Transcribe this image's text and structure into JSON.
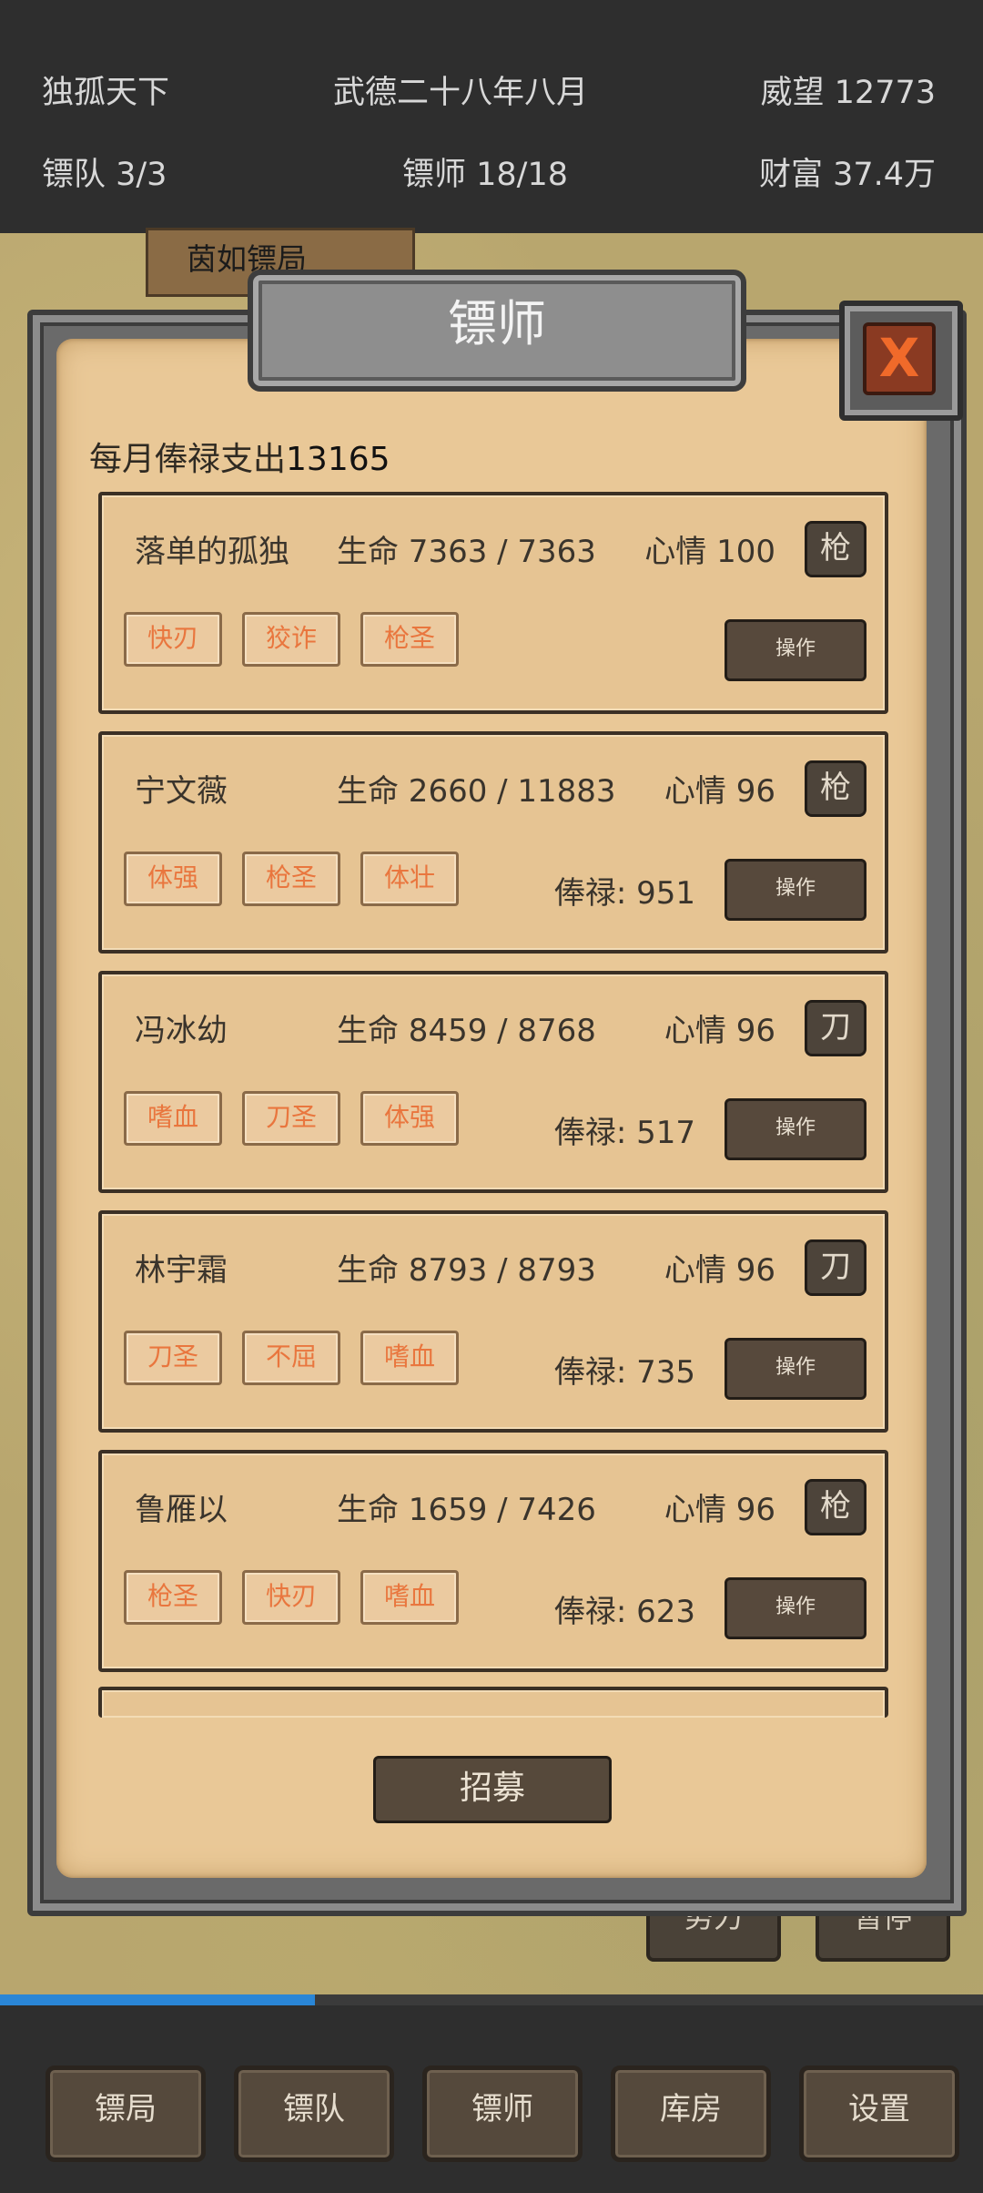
{
  "header": {
    "guild_name": "独孤天下",
    "date": "武德二十八年八月",
    "prestige": "威望 12773",
    "teams": "镖队 3/3",
    "escorts": "镖师 18/18",
    "wealth": "财富  37.4万"
  },
  "map": {
    "building_label": "茵如镖局",
    "btn_left": "势力",
    "btn_right": "暂停",
    "progress_percent": 32,
    "progress_color": "#2a86d6"
  },
  "dialog": {
    "title": "镖师",
    "close_symbol": "X",
    "salary_label": "每月俸禄支出",
    "salary_total": "13165",
    "recruit_label": "招募",
    "operate_label": "操作"
  },
  "escorts": [
    {
      "name": "落单的孤独",
      "hp": "生命 7363 / 7363",
      "mood": "心情 100",
      "weapon": "枪",
      "tags": [
        "快刃",
        "狡诈",
        "枪圣"
      ],
      "pay": ""
    },
    {
      "name": "宁文薇",
      "hp": "生命 2660 / 11883",
      "mood": "心情 96",
      "weapon": "枪",
      "tags": [
        "体强",
        "枪圣",
        "体壮"
      ],
      "pay": "俸禄: 951"
    },
    {
      "name": "冯冰幼",
      "hp": "生命 8459 / 8768",
      "mood": "心情 96",
      "weapon": "刀",
      "tags": [
        "嗜血",
        "刀圣",
        "体强"
      ],
      "pay": "俸禄: 517"
    },
    {
      "name": "林宇霜",
      "hp": "生命 8793 / 8793",
      "mood": "心情 96",
      "weapon": "刀",
      "tags": [
        "刀圣",
        "不屈",
        "嗜血"
      ],
      "pay": "俸禄: 735"
    },
    {
      "name": "鲁雁以",
      "hp": "生命 1659 / 7426",
      "mood": "心情 96",
      "weapon": "枪",
      "tags": [
        "枪圣",
        "快刃",
        "嗜血"
      ],
      "pay": "俸禄: 623"
    }
  ],
  "bottom_nav": [
    "镖局",
    "镖队",
    "镖师",
    "库房",
    "设置"
  ]
}
